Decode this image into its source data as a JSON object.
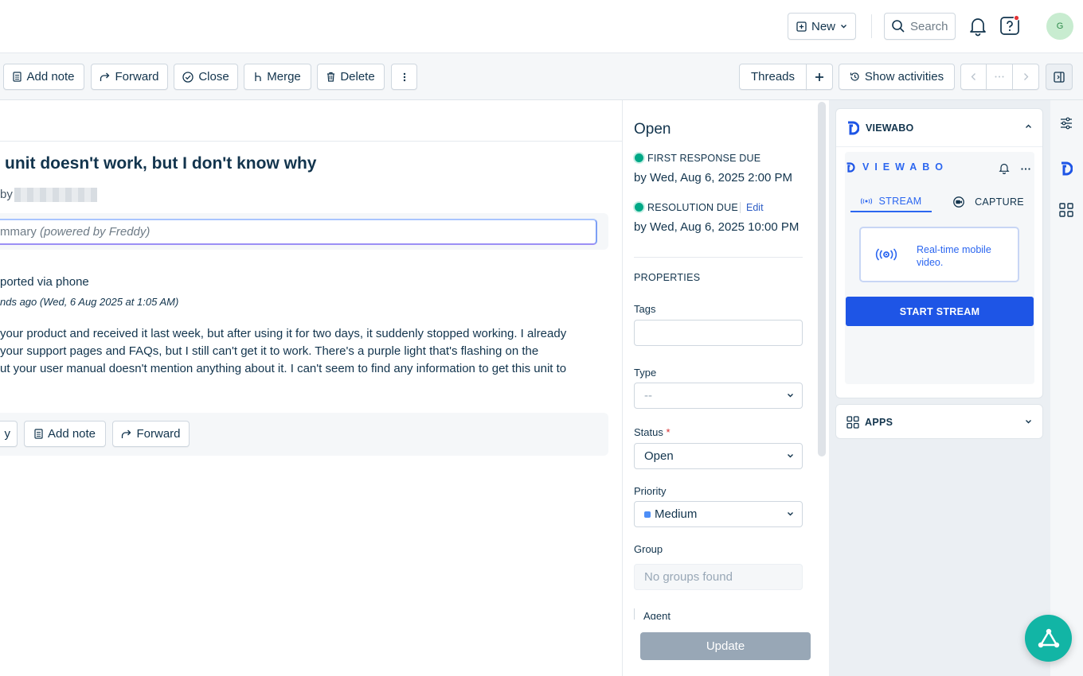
{
  "topbar": {
    "new_label": "New",
    "search_label": "Search",
    "avatar_initial": "G"
  },
  "toolbar": {
    "add_note": "Add note",
    "forward": "Forward",
    "close": "Close",
    "merge": "Merge",
    "delete": "Delete",
    "threads": "Threads",
    "show_activities": "Show activities"
  },
  "ticket": {
    "title": "unit doesn't work, but I don't know why",
    "by_prefix": "by",
    "summary_label": "mmary",
    "summary_note": "(powered by Freddy)",
    "reported": "ported via phone",
    "time": "nds ago (Wed, 6 Aug 2025 at 1:05 AM)",
    "body_lines": [
      "your product and received it last week, but after using it for two days, it suddenly stopped working. I already",
      "your support pages and FAQs, but I still can't get it to work. There's a purple light that's flashing on the",
      "ut your user manual doesn't mention anything about it. I can't seem to find any information to get this unit to"
    ],
    "reply_partial": "y",
    "add_note": "Add note",
    "forward": "Forward"
  },
  "properties": {
    "status_heading": "Open",
    "first_response_label": "FIRST RESPONSE DUE",
    "first_response_value": "by Wed, Aug 6, 2025 2:00 PM",
    "resolution_label": "RESOLUTION DUE",
    "resolution_edit": "Edit",
    "resolution_value": "by Wed, Aug 6, 2025 10:00 PM",
    "section": "PROPERTIES",
    "tags_label": "Tags",
    "type_label": "Type",
    "type_value": "--",
    "status_label": "Status",
    "status_required": "*",
    "status_value": "Open",
    "priority_label": "Priority",
    "priority_value": "Medium",
    "group_label": "Group",
    "group_value": "No groups found",
    "agent_label": "Agent",
    "update": "Update"
  },
  "viewabo": {
    "header": "VIEWABO",
    "logo_text": "VIEWABO",
    "stream_tab": "STREAM",
    "capture_tab": "CAPTURE",
    "card_text": "Real-time mobile video.",
    "start": "START STREAM",
    "apps": "APPS"
  },
  "colors": {
    "accent": "#2563eb",
    "green": "#00a886",
    "teal_fab": "#12b5a5",
    "update_disabled": "#98a7b6",
    "priority": "#4d8ef7"
  }
}
